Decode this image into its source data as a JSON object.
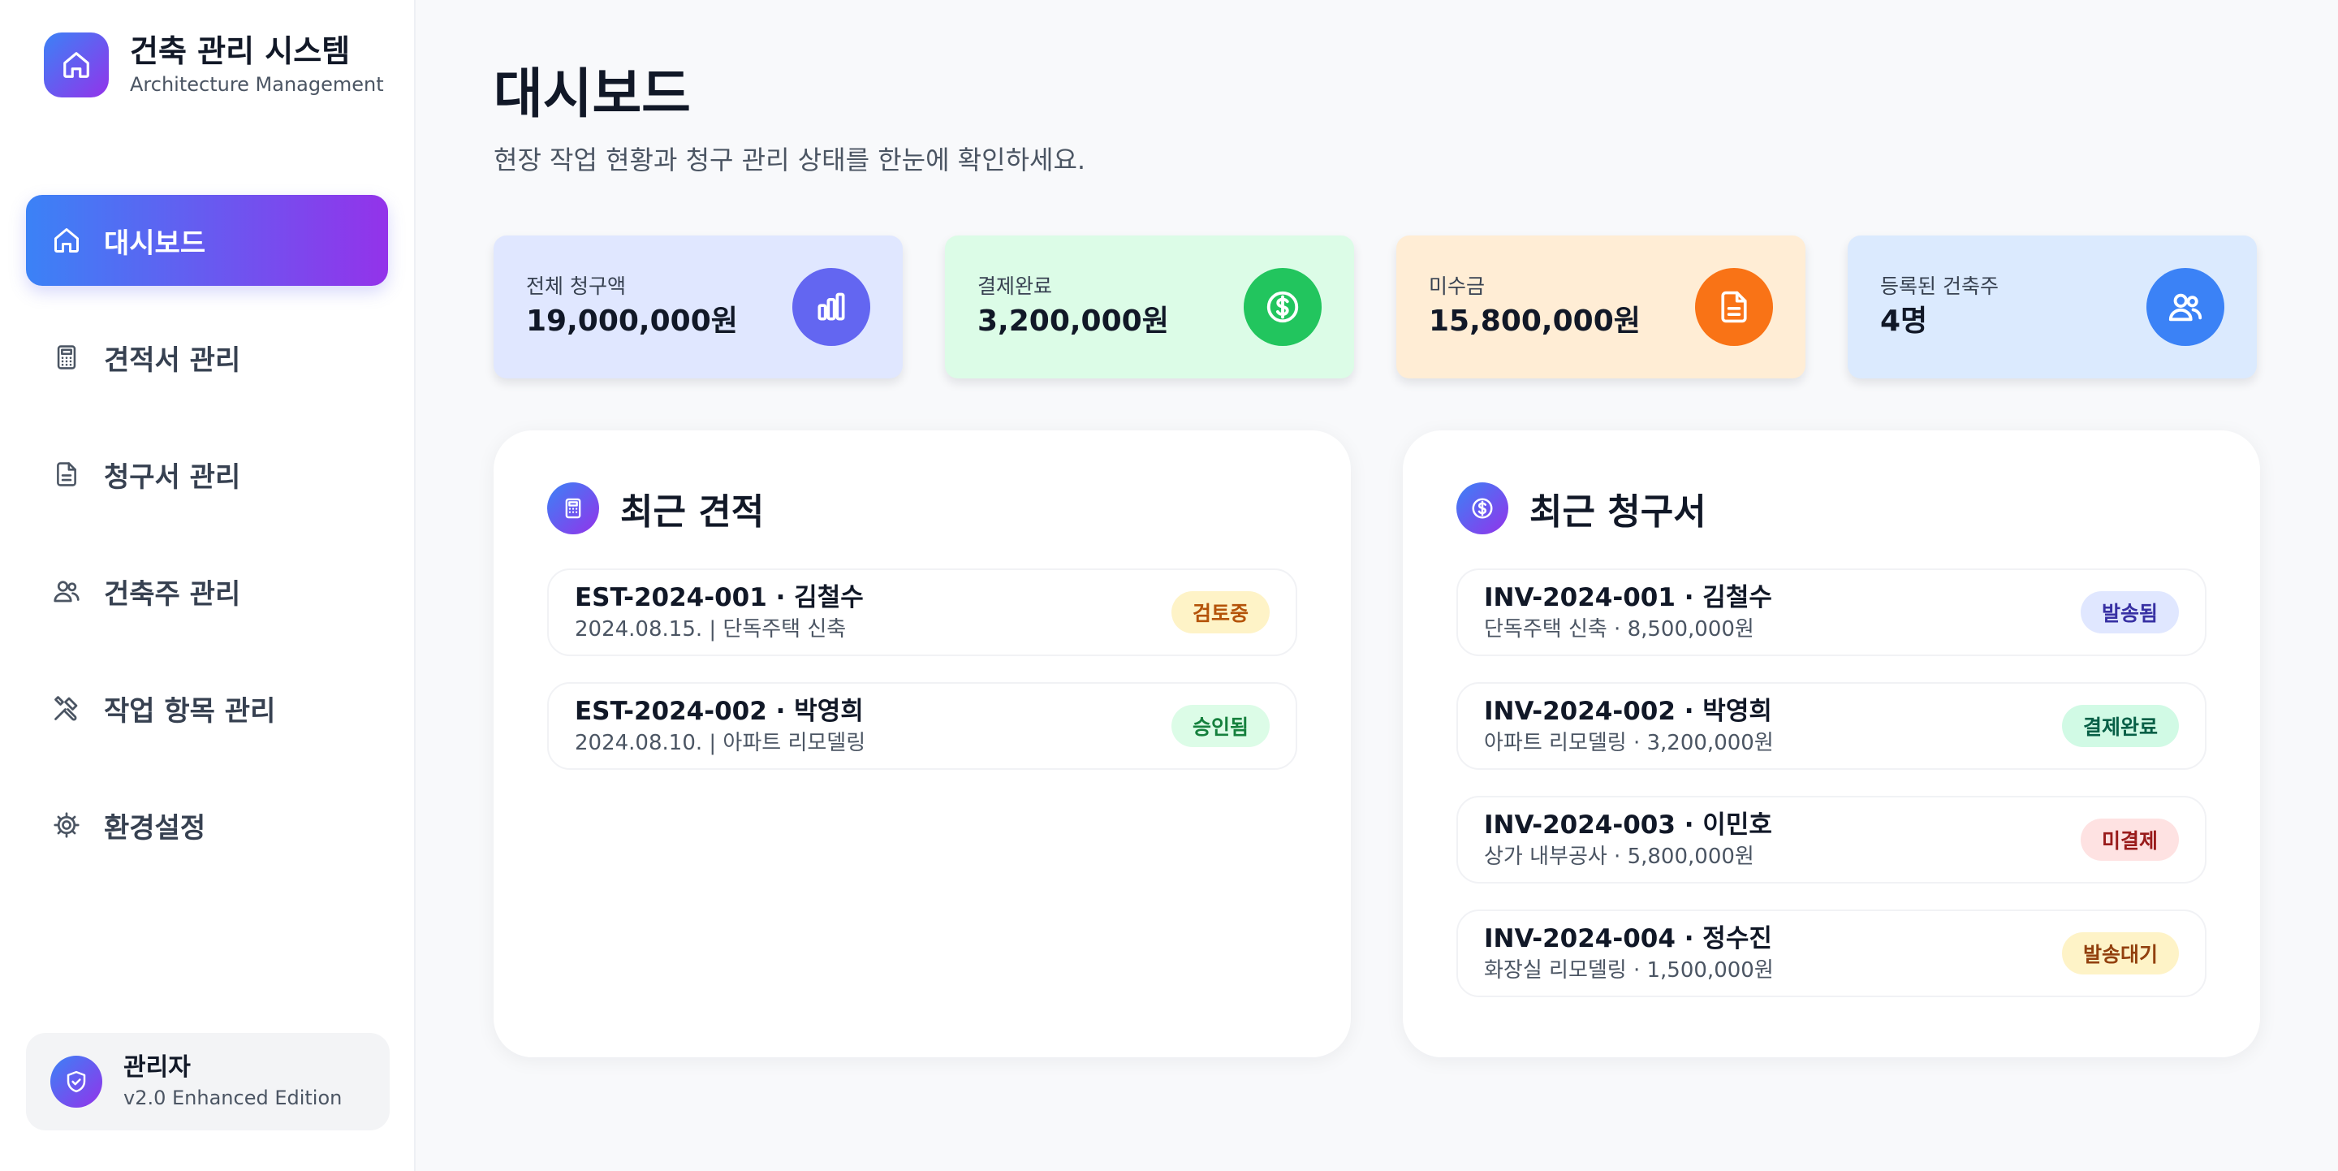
{
  "brand": {
    "title": "건축 관리 시스템",
    "subtitle": "Architecture Management",
    "logo_icon": "home-icon"
  },
  "sidebar": {
    "items": [
      {
        "label": "대시보드",
        "icon": "home-icon",
        "active": true
      },
      {
        "label": "견적서 관리",
        "icon": "calculator-icon",
        "active": false
      },
      {
        "label": "청구서 관리",
        "icon": "document-icon",
        "active": false
      },
      {
        "label": "건축주 관리",
        "icon": "users-icon",
        "active": false
      },
      {
        "label": "작업 항목 관리",
        "icon": "tools-icon",
        "active": false
      },
      {
        "label": "환경설정",
        "icon": "gear-icon",
        "active": false
      }
    ],
    "admin": {
      "name": "관리자",
      "version": "v2.0 Enhanced Edition",
      "icon": "shield-icon"
    }
  },
  "header": {
    "title": "대시보드",
    "subtitle": "현장 작업 현황과 청구 관리 상태를 한눈에 확인하세요."
  },
  "stats": [
    {
      "label": "전체 청구액",
      "value": "19,000,000원",
      "icon": "bar-chart-icon",
      "bg": "#e0e7ff",
      "icon_bg": "#6366f1"
    },
    {
      "label": "결제완료",
      "value": "3,200,000원",
      "icon": "dollar-icon",
      "bg": "#dcfce7",
      "icon_bg": "#22c55e"
    },
    {
      "label": "미수금",
      "value": "15,800,000원",
      "icon": "document-icon",
      "bg": "#ffedd5",
      "icon_bg": "#f97316"
    },
    {
      "label": "등록된 건축주",
      "value": "4명",
      "icon": "users-icon",
      "bg": "#dbeafe",
      "icon_bg": "#3b82f6"
    }
  ],
  "estimates": {
    "title": "최근 견적",
    "icon": "calculator-icon",
    "items": [
      {
        "title": "EST-2024-001 · 김철수",
        "sub": "2024.08.15. | 단독주택 신축",
        "badge": "검토중",
        "badge_bg": "#fef3c7",
        "badge_fg": "#b45309"
      },
      {
        "title": "EST-2024-002 · 박영희",
        "sub": "2024.08.10. | 아파트 리모델링",
        "badge": "승인됨",
        "badge_bg": "#dcfce7",
        "badge_fg": "#15803d"
      }
    ]
  },
  "invoices": {
    "title": "최근 청구서",
    "icon": "dollar-icon",
    "items": [
      {
        "title": "INV-2024-001 · 김철수",
        "sub": "단독주택 신축 · 8,500,000원",
        "badge": "발송됨",
        "badge_bg": "#e0e7ff",
        "badge_fg": "#3730a3"
      },
      {
        "title": "INV-2024-002 · 박영희",
        "sub": "아파트 리모델링 · 3,200,000원",
        "badge": "결제완료",
        "badge_bg": "#d1fae5",
        "badge_fg": "#065f46"
      },
      {
        "title": "INV-2024-003 · 이민호",
        "sub": "상가 내부공사 · 5,800,000원",
        "badge": "미결제",
        "badge_bg": "#fee2e2",
        "badge_fg": "#991b1b"
      },
      {
        "title": "INV-2024-004 · 정수진",
        "sub": "화장실 리모델링 · 1,500,000원",
        "badge": "발송대기",
        "badge_bg": "#fef3c7",
        "badge_fg": "#92400e"
      }
    ]
  }
}
